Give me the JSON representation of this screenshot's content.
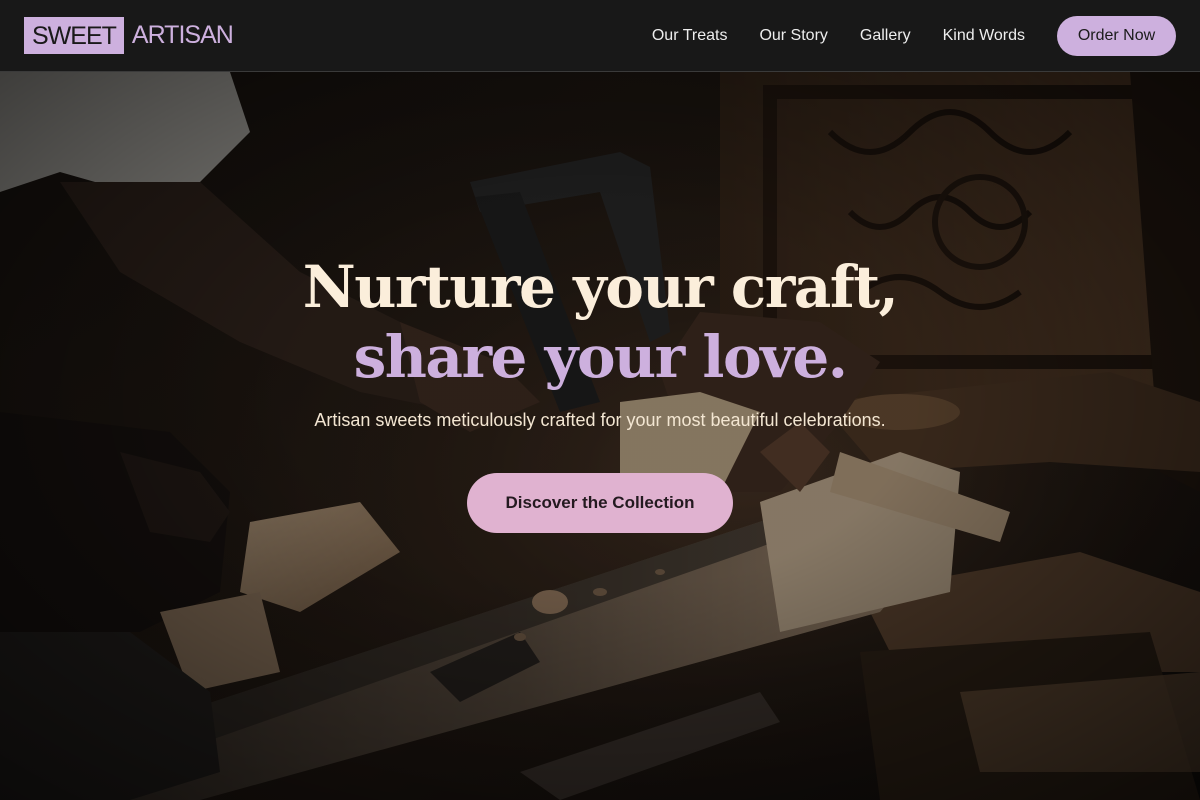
{
  "brand": {
    "part1": "SWEET",
    "part2": "ARTISAN",
    "accent_color": "#cdb0de"
  },
  "nav": {
    "items": [
      {
        "label": "Our Treats"
      },
      {
        "label": "Our Story"
      },
      {
        "label": "Gallery"
      },
      {
        "label": "Kind Words"
      }
    ],
    "cta_label": "Order Now"
  },
  "hero": {
    "headline_line1": "Nurture your craft,",
    "headline_line2": "share your love.",
    "subheadline": "Artisan sweets meticulously crafted for your most beautiful celebrations.",
    "cta_label": "Discover the Collection",
    "background_image": "woodworker-carving-wood-photo",
    "headline_color": "#fbeedb",
    "headline_accent_color": "#cdb0de",
    "cta_color": "#e0b2d0"
  }
}
